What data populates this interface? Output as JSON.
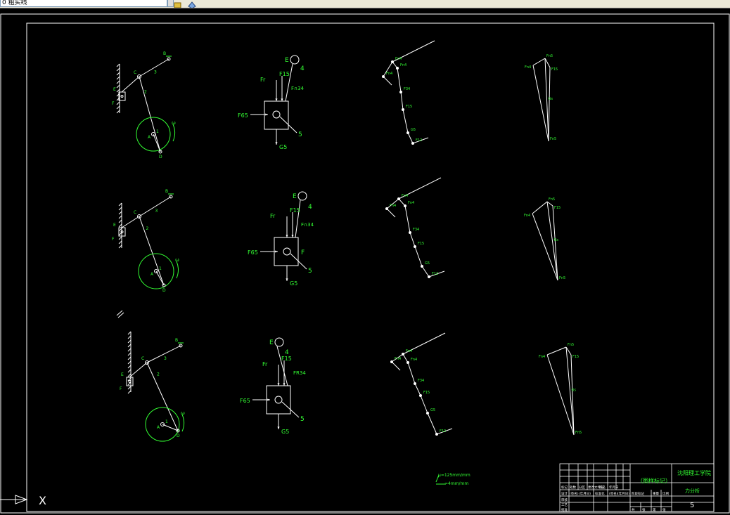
{
  "toolbar": {
    "layer_field": "0 粗实线",
    "icons": [
      "layer-state-icon",
      "layer-props-icon"
    ]
  },
  "colors": {
    "lines": "#ffffff",
    "labels": "#33ff33",
    "background": "#000000"
  },
  "rows": [
    {
      "mech": {
        "top": "B",
        "n1": "1",
        "n2": "2",
        "n3": "3",
        "ext": "E",
        "side": "F",
        "label_c": "C",
        "label_a": "A",
        "label_d": "D",
        "omega": "ω"
      },
      "fbd": {
        "e": "E",
        "num4": "4",
        "num5": "5",
        "ff": "Fr",
        "f15": "F15",
        "f34": "F∩34",
        "f65": "F65",
        "g5": "G5",
        "f": ""
      },
      "poly": {
        "t1": "Fn4",
        "t2": "Fn4",
        "t3": "Fn4",
        "t4": "F34",
        "t5": "F15",
        "t6": "G5",
        "t7": "F12"
      },
      "tri": {
        "a": "Fn4",
        "b": "Fn5",
        "c": "F15",
        "d": "Gs",
        "e": "Fn5"
      }
    },
    {
      "mech": {
        "top": "B",
        "n1": "1",
        "n2": "2",
        "n3": "3",
        "ext": "E",
        "side": "F",
        "label_c": "C",
        "label_a": "A",
        "label_d": "D",
        "omega": "ω"
      },
      "fbd": {
        "e": "E",
        "num4": "4",
        "num5": "5",
        "ff": "Fr",
        "f15": "F15",
        "f34": "F∩34",
        "f65": "F65",
        "g5": "G5",
        "f": "F"
      },
      "poly": {
        "t1": "Fn4",
        "t2": "Fn4",
        "t3": "Fn4",
        "t4": "F34",
        "t5": "F15",
        "t6": "G5",
        "t7": "F12"
      },
      "tri": {
        "a": "Fn4",
        "b": "Fn5",
        "c": "F15",
        "d": "Gs",
        "e": "Fn5"
      }
    },
    {
      "mech": {
        "top": "B",
        "n1": "1",
        "n2": "2",
        "n3": "3",
        "ext": "E",
        "side": "F",
        "label_c": "C",
        "label_a": "A",
        "label_d": "D",
        "omega": "ω"
      },
      "fbd": {
        "e": "E",
        "num4": "4",
        "num5": "5",
        "ff": "Fr",
        "f15": "F15",
        "f34": "FR34",
        "f65": "F65",
        "g5": "G5",
        "f": ""
      },
      "poly": {
        "t1": "Fn4",
        "t2": "Fn4",
        "t3": "Fn4",
        "t4": "F34",
        "t5": "F15",
        "t6": "G5",
        "t7": "F12"
      },
      "tri": {
        "a": "Fn4",
        "b": "Fn5",
        "c": "F15",
        "d": "Gs",
        "e": "Fn5"
      }
    }
  ],
  "scale_note": {
    "line1": "μ=125mm/mm",
    "line2": "=4mm/mm"
  },
  "title_block": {
    "title": "（图样标记）",
    "school": "沈阳理工学院",
    "drawing_name": "力分析",
    "sheet_no": "5",
    "cells": [
      "标记",
      "处数",
      "分区",
      "更改文件号",
      "签名",
      "年月日",
      "设计",
      "(签名)",
      "(年月日)",
      "标准化",
      "(签名)",
      "(年月日)",
      "阶段标记",
      "重量",
      "比例",
      "审核",
      "工艺",
      "批准",
      "共",
      "张",
      "第",
      "张"
    ]
  },
  "ucs": {
    "x_label": "X"
  }
}
